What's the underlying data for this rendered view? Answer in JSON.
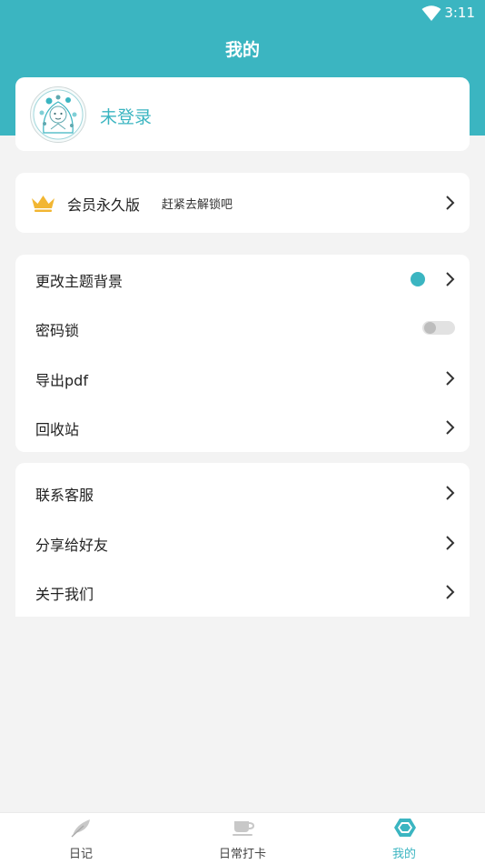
{
  "status_bar": {
    "time": "3:11"
  },
  "header": {
    "title": "我的"
  },
  "profile": {
    "login_text": "未登录"
  },
  "vip": {
    "label": "会员永久版",
    "subtitle": "赶紧去解锁吧"
  },
  "settings": {
    "items": [
      {
        "label": "更改主题背景"
      },
      {
        "label": "密码锁",
        "toggle_on": false
      },
      {
        "label": "导出pdf"
      },
      {
        "label": "回收站"
      }
    ]
  },
  "support": {
    "items": [
      {
        "label": "联系客服"
      },
      {
        "label": "分享给好友"
      },
      {
        "label": "关于我们"
      }
    ]
  },
  "bottom_nav": {
    "items": [
      {
        "label": "日记",
        "icon": "feather-icon"
      },
      {
        "label": "日常打卡",
        "icon": "coffee-cup-icon"
      },
      {
        "label": "我的",
        "icon": "hexagon-icon",
        "active": true
      }
    ]
  },
  "colors": {
    "accent": "#3bb5c1",
    "background": "#f3f3f3",
    "crown": "#f2b632"
  }
}
